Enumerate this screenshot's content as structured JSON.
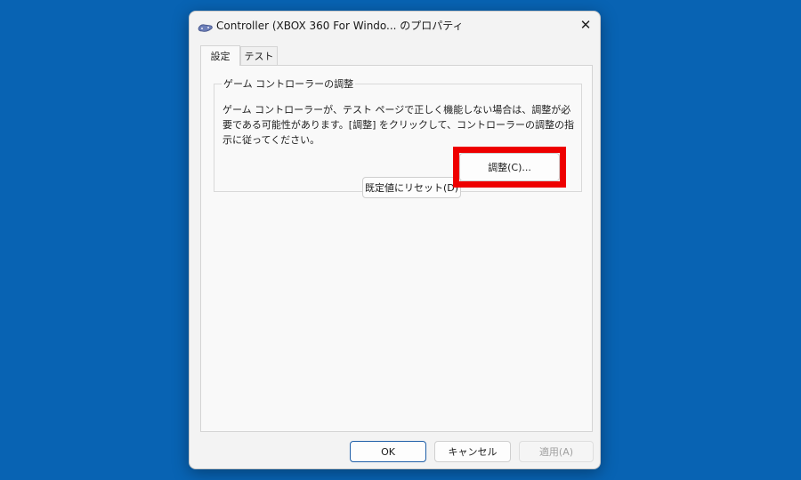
{
  "window": {
    "title": "Controller (XBOX 360 For Windo... のプロパティ",
    "close_glyph": "✕"
  },
  "tabs": [
    {
      "label": "設定",
      "active": true
    },
    {
      "label": "テスト",
      "active": false
    }
  ],
  "group": {
    "title": "ゲーム コントローラーの調整",
    "description": "ゲーム コントローラーが、テスト ページで正しく機能しない場合は、調整が必要である可能性があります。[調整] をクリックして、コントローラーの調整の指示に従ってください。",
    "reset_label": "既定値にリセット(D)",
    "calibrate_label": "調整(C)..."
  },
  "footer": {
    "ok_label": "OK",
    "cancel_label": "キャンセル",
    "apply_label": "適用(A)"
  },
  "colors": {
    "desktop": "#0863b3",
    "highlight": "#ee0000",
    "ok_border": "#1f5fa8"
  },
  "icons": {
    "app": "gamepad-icon",
    "close": "close-icon"
  }
}
